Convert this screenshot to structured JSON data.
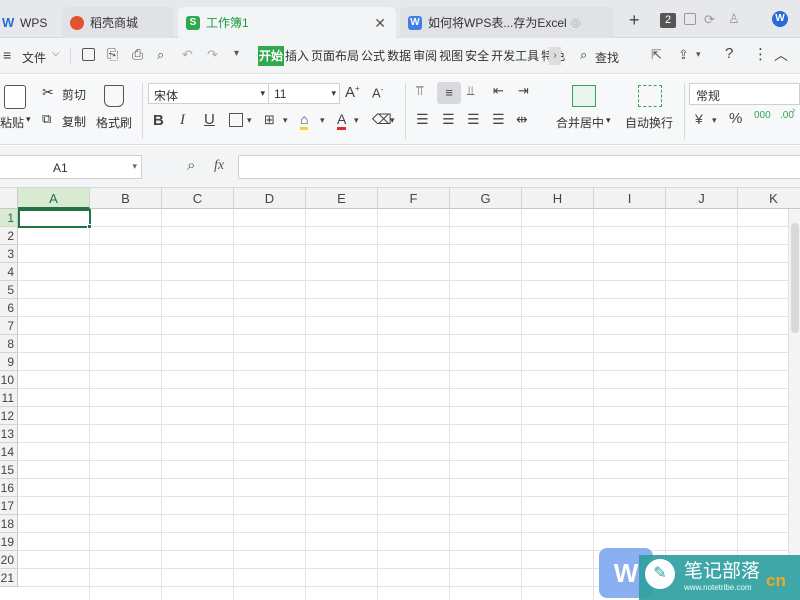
{
  "tabs": [
    {
      "label": "WPS",
      "icon": "wps-logo-icon"
    },
    {
      "label": "稻壳商城",
      "icon": "docer-icon"
    },
    {
      "label": "工作簿1",
      "icon": "spreadsheet-icon",
      "active": true
    },
    {
      "label": "如何将WPS表...存为Excel",
      "icon": "writer-doc-icon"
    }
  ],
  "tab_counter": "2",
  "menu": {
    "file": "文件",
    "items": [
      "开始",
      "插入",
      "页面布局",
      "公式",
      "数据",
      "审阅",
      "视图",
      "安全",
      "开发工具",
      "特色"
    ],
    "search": "查找"
  },
  "ribbon": {
    "paste": "粘贴",
    "cut": "剪切",
    "copy": "复制",
    "format_painter": "格式刷",
    "font_name": "宋体",
    "font_size": "11",
    "merge_center": "合并居中",
    "wrap_text": "自动换行",
    "number_format": "常规"
  },
  "formula": {
    "cell_ref": "A1",
    "fx": "fx",
    "value": ""
  },
  "columns": [
    "A",
    "B",
    "C",
    "D",
    "E",
    "F",
    "G",
    "H",
    "I",
    "J",
    "K"
  ],
  "rows": [
    "1",
    "2",
    "3",
    "4",
    "5",
    "6",
    "7",
    "8",
    "9",
    "10",
    "11",
    "12",
    "13",
    "14",
    "15",
    "16",
    "17",
    "18",
    "19",
    "20",
    "21"
  ],
  "watermark": {
    "text": "笔记部落",
    "url": "www.notetribe.com",
    "cn": "cn"
  }
}
